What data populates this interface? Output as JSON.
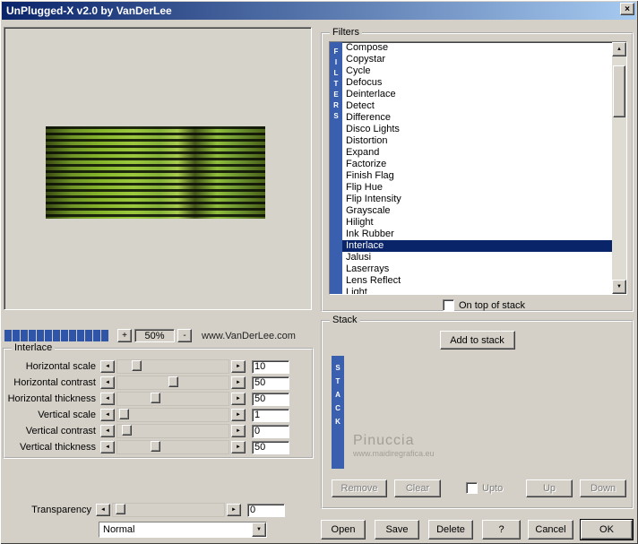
{
  "window": {
    "title": "UnPlugged-X v2.0 by VanDerLee"
  },
  "icons": {
    "close": "×",
    "up": "▲",
    "down": "▼",
    "left": "◄",
    "right": "►",
    "dropdown": "▼"
  },
  "preview": {
    "progress_segments": 13,
    "zoom_plus": "+",
    "zoom_value": "50%",
    "zoom_minus": "-",
    "website": "www.VanDerLee.com"
  },
  "interlace": {
    "title": "Interlace",
    "sliders": [
      {
        "label": "Horizontal scale",
        "value": "10",
        "percent": 14
      },
      {
        "label": "Horizontal contrast",
        "value": "50",
        "percent": 50
      },
      {
        "label": "Horizontal thickness",
        "value": "50",
        "percent": 33
      },
      {
        "label": "Vertical scale",
        "value": "1",
        "percent": 2
      },
      {
        "label": "Vertical contrast",
        "value": "0",
        "percent": 4
      },
      {
        "label": "Vertical thickness",
        "value": "50",
        "percent": 33
      }
    ]
  },
  "transparency": {
    "label": "Transparency",
    "value": "0",
    "percent": 3,
    "blend_mode": "Normal"
  },
  "filters": {
    "title": "Filters",
    "vertical_label": "FILTERS",
    "selected_index": 17,
    "on_top_label": "On top of stack",
    "items": [
      "Compose",
      "Copystar",
      "Cycle",
      "Defocus",
      "Deinterlace",
      "Detect",
      "Difference",
      "Disco Lights",
      "Distortion",
      "Expand",
      "Factorize",
      "Finish Flag",
      "Flip Hue",
      "Flip Intensity",
      "Grayscale",
      "Hilight",
      "Ink Rubber",
      "Interlace",
      "Jalusi",
      "Laserrays",
      "Lens Reflect",
      "Light"
    ]
  },
  "stack": {
    "title": "Stack",
    "add_button": "Add to stack",
    "vertical_label": "STACK",
    "watermark_name": "Pinuccia",
    "watermark_site": "www.maidiregrafica.eu",
    "remove_button": "Remove",
    "clear_button": "Clear",
    "upto_label": "Upto",
    "up_button": "Up",
    "down_button": "Down"
  },
  "actions": {
    "open": "Open",
    "save": "Save",
    "delete": "Delete",
    "help": "?",
    "cancel": "Cancel",
    "ok": "OK"
  },
  "colors": {
    "titlebar_start": "#0a246a",
    "titlebar_end": "#a6caf0",
    "selection": "#0a246a",
    "accent_bar": "#3a5fae",
    "progress_block": "#2e55a8",
    "dialog_bg": "#d4d0c8"
  }
}
